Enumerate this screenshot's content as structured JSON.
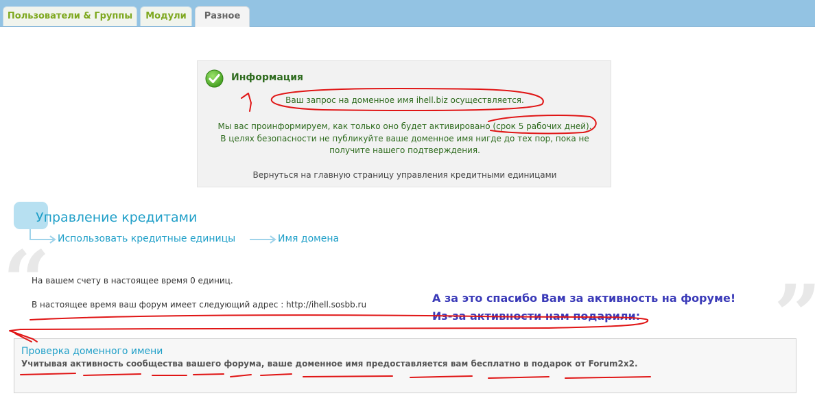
{
  "tabs": [
    {
      "label": "Пользователи & Группы",
      "active": false
    },
    {
      "label": "Модули",
      "active": false
    },
    {
      "label": "Разное",
      "active": true
    }
  ],
  "info": {
    "icon": "check-icon",
    "title": "Информация",
    "line1": "Ваш запрос на доменное имя ihell.biz осуществляется.",
    "line2": "Мы вас проинформируем, как только оно будет активировано (срок 5 рабочих дней).",
    "line3": "В целях безопасности не публикуйте ваше доменное имя нигде до тех пор, пока не",
    "line4": "получите нашего подтверждения.",
    "back_link": "Вернуться на главную страницу управления кредитными единицами"
  },
  "credits": {
    "title": "Управление кредитами",
    "breadcrumb": [
      "Использовать кредитные единицы",
      "Имя домена"
    ],
    "account_text": "На вашем счету в настоящее время 0 единиц.",
    "address_text": "В настоящее время ваш форум имеет следующий адрес : http://ihell.sosbb.ru"
  },
  "annotation": {
    "line1": "А за это спасибо Вам за активность на форуме!",
    "line2": "Из-за активности нам подарили:"
  },
  "domain_check": {
    "title": "Проверка доменного имени",
    "text": "Учитывая активность сообщества вашего форума, ваше доменное имя предоставляется вам бесплатно в подарок от Forum2x2."
  },
  "colors": {
    "tabbar": "#93c3e3",
    "tab_inactive_text": "#7ea81f",
    "info_green": "#2e6b1e",
    "accent_blue": "#1f9fc8",
    "annotation_blue": "#3a3ab8",
    "markup_red": "#e01515"
  }
}
